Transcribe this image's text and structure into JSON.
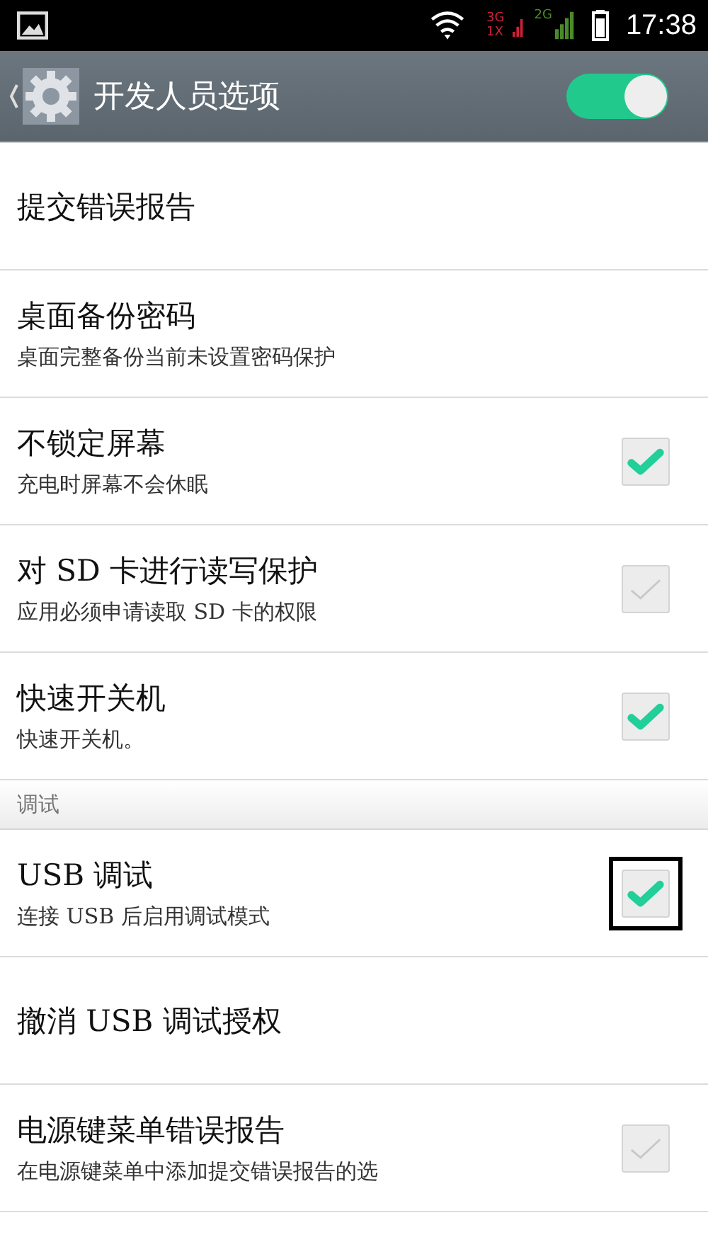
{
  "status_bar": {
    "time": "17:38",
    "sim1": [
      "3G",
      "1X"
    ],
    "sim2": "2G"
  },
  "header": {
    "title": "开发人员选项",
    "master_switch": {
      "on": true
    }
  },
  "items": [
    {
      "kind": "plain",
      "title": "提交错误报告"
    },
    {
      "kind": "plain",
      "title": "桌面备份密码",
      "summary": "桌面完整备份当前未设置密码保护"
    },
    {
      "kind": "checkbox",
      "title": "不锁定屏幕",
      "summary": "充电时屏幕不会休眠",
      "checked": true,
      "disabled": false,
      "highlighted": false
    },
    {
      "kind": "checkbox",
      "title": "对 SD 卡进行读写保护",
      "summary": "应用必须申请读取 SD 卡的权限",
      "disabled": true,
      "highlighted": false
    },
    {
      "kind": "checkbox",
      "title": "快速开关机",
      "summary": "快速开关机。",
      "checked": true,
      "disabled": false,
      "highlighted": false
    },
    {
      "kind": "section",
      "title": "调试"
    },
    {
      "kind": "checkbox",
      "title": "USB 调试",
      "summary": "连接 USB 后启用调试模式",
      "checked": true,
      "disabled": false,
      "highlighted": true
    },
    {
      "kind": "plain",
      "title": "撤消 USB 调试授权"
    },
    {
      "kind": "checkbox",
      "title": "电源键菜单错误报告",
      "summary": "在电源键菜单中添加提交错误报告的选",
      "disabled": true,
      "highlighted": false
    }
  ]
}
